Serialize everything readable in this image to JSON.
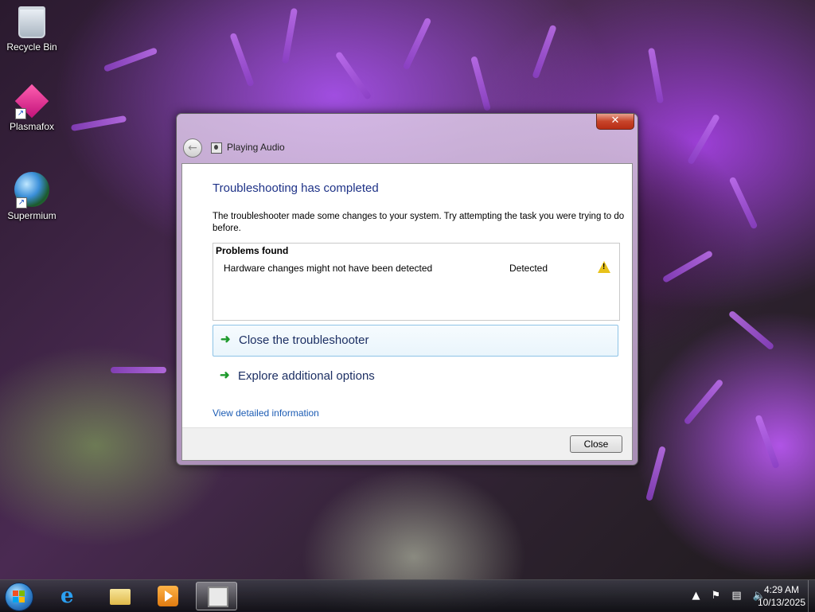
{
  "desktop": {
    "icons": [
      {
        "label": "Recycle Bin",
        "icon": "recycle-bin-icon"
      },
      {
        "label": "Plasmafox",
        "icon": "plasmafox-icon"
      },
      {
        "label": "Supermium",
        "icon": "supermium-icon"
      }
    ]
  },
  "window": {
    "title": "Playing Audio",
    "close_glyph": "✕",
    "heading": "Troubleshooting has completed",
    "description": "The troubleshooter made some changes to your system. Try attempting the task you were trying to do before.",
    "problems": {
      "header": "Problems found",
      "items": [
        {
          "name": "Hardware changes might not have been detected",
          "status": "Detected",
          "icon": "warning-icon"
        }
      ]
    },
    "commands": [
      {
        "label": "Close the troubleshooter",
        "icon": "green-arrow-icon"
      },
      {
        "label": "Explore additional options",
        "icon": "green-arrow-icon"
      }
    ],
    "detail_link": "View detailed information",
    "close_button": "Close"
  },
  "taskbar": {
    "items": [
      {
        "name": "internet-explorer",
        "icon": "internet-explorer-icon"
      },
      {
        "name": "file-explorer",
        "icon": "folder-icon"
      },
      {
        "name": "media-player",
        "icon": "media-player-icon"
      },
      {
        "name": "troubleshooter",
        "icon": "troubleshooter-icon",
        "active": true
      }
    ],
    "tray_expand": "▲",
    "clock_time": "4:29 AM",
    "clock_date": "10/13/2025"
  },
  "colors": {
    "heading": "#1e3287",
    "link": "#1c5cb4",
    "command_arrow": "#1e9a2c",
    "warning": "#e8c21a"
  }
}
